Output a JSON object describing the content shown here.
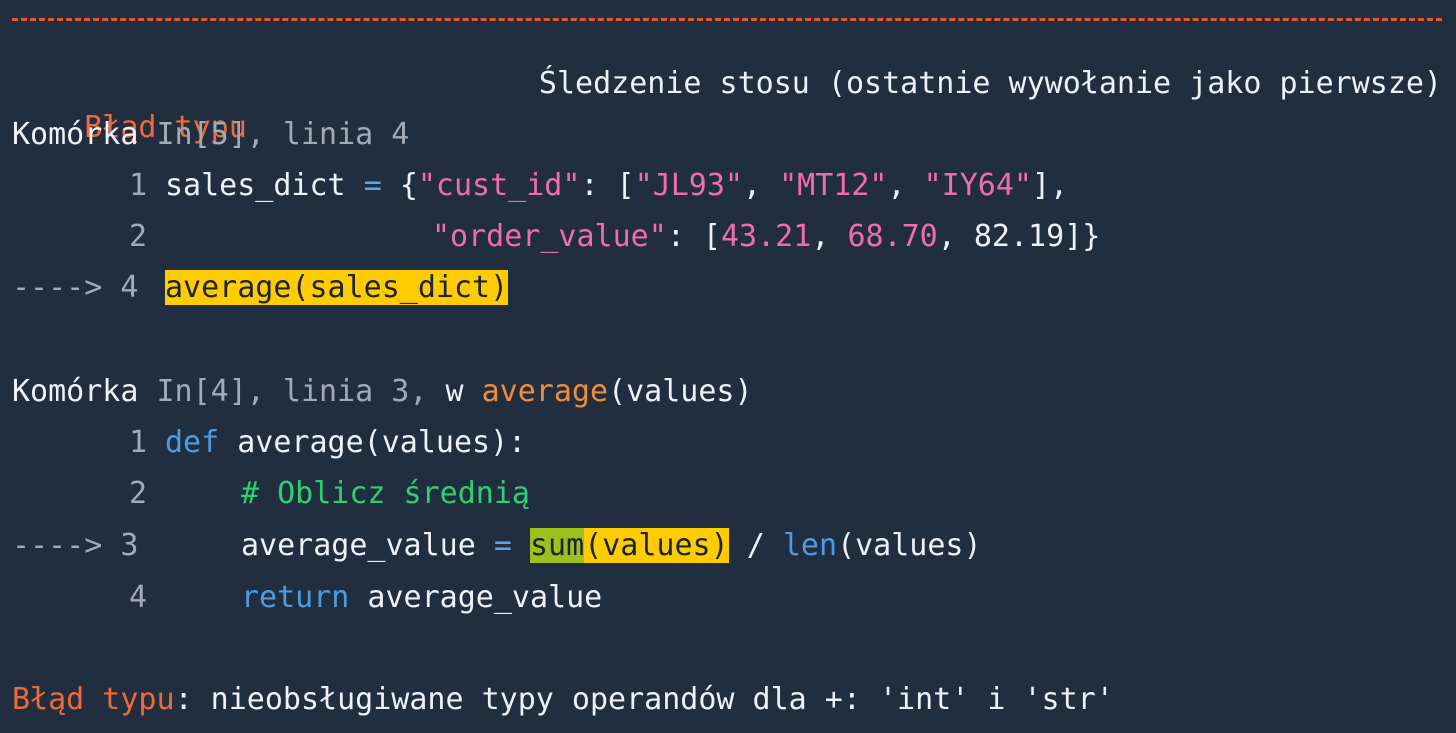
{
  "header": {
    "separator": "------------------------------------------------------------",
    "error_type": "Błąd typu",
    "traceback_title": "Śledzenie stosu (ostatnie wywołanie jako pierwsze)"
  },
  "frame1": {
    "location_prefix": "Komórka",
    "location_detail": "In[5], linia 4",
    "lines": [
      {
        "num": "1",
        "marker": "",
        "code": {
          "var": "sales_dict",
          "eq": "=",
          "open": "{",
          "key1": "\"cust_id\"",
          "colon1": ": [",
          "s1": "\"JL93\"",
          "c1": ", ",
          "s2": "\"MT12\"",
          "c2": ", ",
          "s3": "\"IY64\"",
          "close1": "],"
        }
      },
      {
        "num": "2",
        "marker": "",
        "code": {
          "key2": "\"order_value\"",
          "colon2": ": [",
          "n1": "43.21",
          "c1": ", ",
          "n2": "68.70",
          "c2": ", ",
          "n3": "82.19",
          "close2": "]}"
        }
      },
      {
        "num": "4",
        "marker": "---->",
        "code": {
          "call": "average(sales_dict)"
        }
      }
    ]
  },
  "frame2": {
    "location_prefix": "Komórka",
    "location_detail": "In[4], linia 3, ",
    "location_w": "w ",
    "location_fn": "average",
    "location_args": "(values)",
    "lines": [
      {
        "num": "1",
        "marker": "",
        "code": {
          "kw": "def",
          "rest": " average(values):"
        }
      },
      {
        "num": "2",
        "marker": "",
        "code": {
          "comment": "# Oblicz średnią"
        }
      },
      {
        "num": "3",
        "marker": "---->",
        "code": {
          "lhs": "average_value",
          "eq": " = ",
          "sum": "sum",
          "args": "(values)",
          "div": " / ",
          "len": "len",
          "rest": "(values)"
        }
      },
      {
        "num": "4",
        "marker": "",
        "code": {
          "kw": "return",
          "rest": " average_value"
        }
      }
    ]
  },
  "footer": {
    "error_type": "Błąd typu",
    "message": ": nieobsługiwane typy operandów dla +: 'int' i 'str'"
  }
}
